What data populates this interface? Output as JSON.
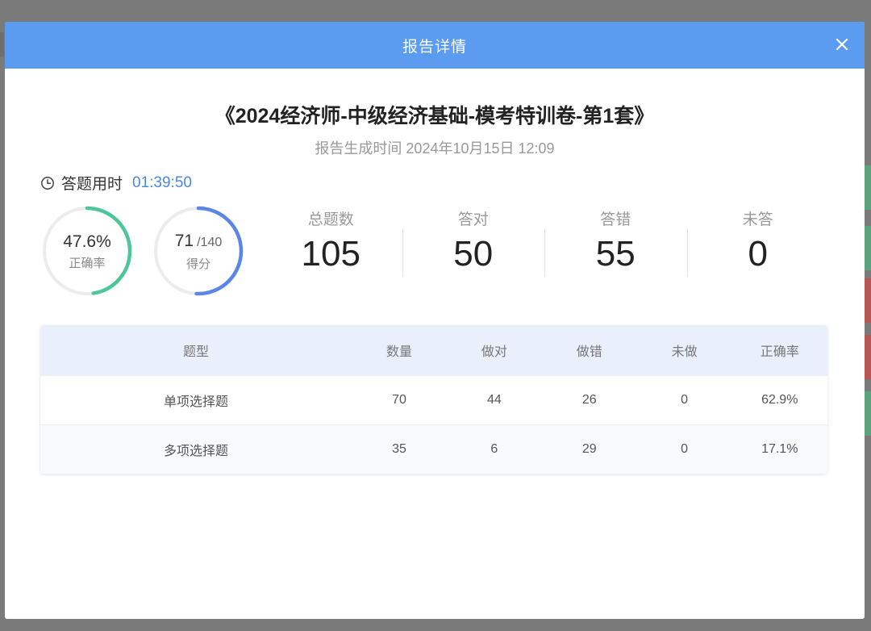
{
  "modal": {
    "title": "报告详情",
    "close_label": "×"
  },
  "report": {
    "exam_title": "《2024经济师-中级经济基础-模考特训卷-第1套》",
    "generated_time": "报告生成时间 2024年10月15日 12:09",
    "duration_label": "答题用时",
    "duration_value": "01:39:50"
  },
  "rings": {
    "accuracy": {
      "value": "47.6%",
      "label": "正确率",
      "fraction": 0.476,
      "color": "#4fc59a"
    },
    "score": {
      "value": "71",
      "suffix": "/140",
      "label": "得分",
      "fraction": 0.507,
      "color": "#5b86e5"
    }
  },
  "stats": [
    {
      "label": "总题数",
      "value": "105"
    },
    {
      "label": "答对",
      "value": "50"
    },
    {
      "label": "答错",
      "value": "55"
    },
    {
      "label": "未答",
      "value": "0"
    }
  ],
  "table": {
    "headers": [
      "题型",
      "数量",
      "做对",
      "做错",
      "未做",
      "正确率"
    ],
    "rows": [
      [
        "单项选择题",
        "70",
        "44",
        "26",
        "0",
        "62.9%"
      ],
      [
        "多项选择题",
        "35",
        "6",
        "29",
        "0",
        "17.1%"
      ]
    ]
  },
  "colors": {
    "header_bg": "#5b9bf0",
    "accent_blue": "#4a86e8",
    "accent_green": "#4fc59a"
  }
}
